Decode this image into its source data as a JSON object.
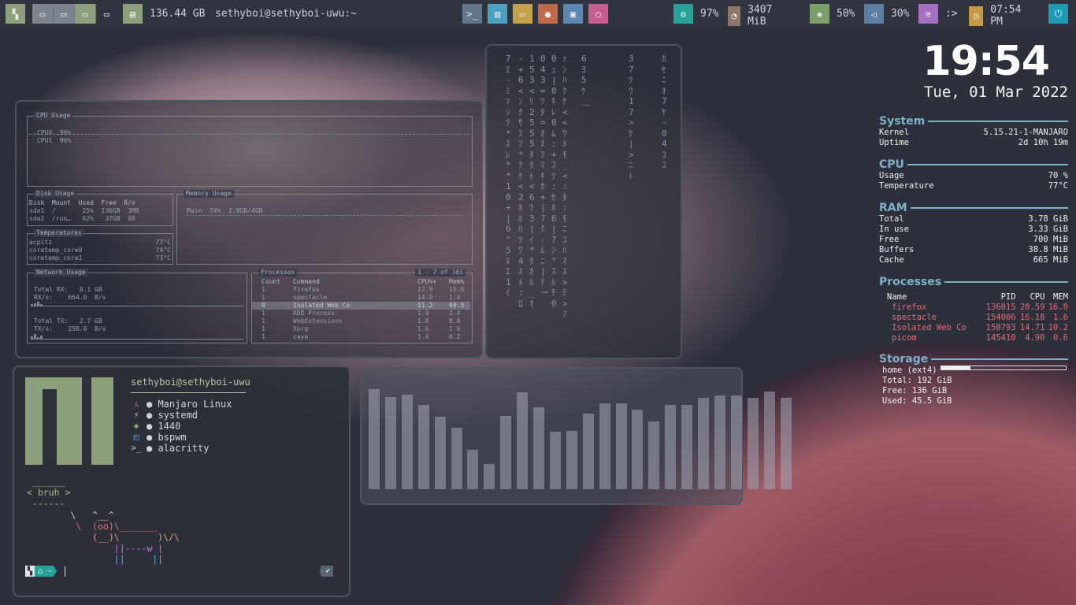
{
  "topbar": {
    "disk_value": "136.44 GB",
    "window_title": "sethyboi@sethyboi-uwu:~",
    "launchers": [
      {
        "name": "terminal-launcher",
        "icon": "terminal-icon",
        "glyph": ">_",
        "color": "#62768a"
      },
      {
        "name": "monitor-launcher",
        "icon": "bar-chart-icon",
        "glyph": "▥",
        "color": "#4ea0c2"
      },
      {
        "name": "files-launcher",
        "icon": "folder-icon",
        "glyph": "▭",
        "color": "#c5a049"
      },
      {
        "name": "firefox-launcher",
        "icon": "firefox-icon",
        "glyph": "●",
        "color": "#c16a4b"
      },
      {
        "name": "save-launcher",
        "icon": "floppy-icon",
        "glyph": "▣",
        "color": "#5d87b3"
      },
      {
        "name": "power-launcher",
        "icon": "circle-icon",
        "glyph": "○",
        "color": "#c65d8c"
      }
    ],
    "modules": [
      {
        "name": "cpu-module",
        "icon": "cpu-icon",
        "glyph": "⚙",
        "value": "97%",
        "color": "#2aa198"
      },
      {
        "name": "memory-module",
        "icon": "pie-icon",
        "glyph": "◔",
        "value": "3407 MiB",
        "color": "#8a7866"
      },
      {
        "name": "brightness-module",
        "icon": "brightness-icon",
        "glyph": "✺",
        "value": "50%",
        "color": "#7d9c69"
      },
      {
        "name": "volume-module",
        "icon": "speaker-icon",
        "glyph": "◁",
        "value": "30%",
        "color": "#5d7fa6"
      },
      {
        "name": "wifi-module",
        "icon": "wifi-icon",
        "glyph": "≋",
        "value": ":>",
        "color": "#a56fc2"
      },
      {
        "name": "clock-module",
        "icon": "clock-icon",
        "glyph": "◷",
        "value": "07:54 PM",
        "color": "#c99a45"
      },
      {
        "name": "power-module",
        "icon": "power-icon",
        "glyph": "⏻",
        "value": "",
        "color": "#1e9bb5"
      }
    ],
    "colors": {
      "bar_bg": "#2f343f",
      "workspace_inactive": "#7d838f",
      "workspace_active": "#8da07b",
      "disk": "#8da07b"
    }
  },
  "bpytop": {
    "cpu_title": "CPU Usage",
    "cpu0": "CPU0  96%",
    "cpu1": "CPU1  96%",
    "disk_title": "Disk Usage",
    "disk_header": "Disk  Mount  Used  Free  R/s",
    "disk_rows": [
      "sda1  /       25%  136GB  3MB",
      "sda2  /run…   62%   37GB  0B"
    ],
    "mem_title": "Memory Usage",
    "mem_main": "Main  74%  2.8GB/4GB",
    "temp_title": "Temperatures",
    "temps": [
      {
        "name": "acpitz",
        "value": "77°C"
      },
      {
        "name": "coretemp_core0",
        "value": "74°C"
      },
      {
        "name": "coretemp_core1",
        "value": "73°C"
      }
    ],
    "net_title": "Network Usage",
    "net_rx_total": "Total RX:   8.1 GB",
    "net_rx": "RX/s:    664.0  B/s",
    "net_tx_total": "Total TX:   2.7 GB",
    "net_tx": "TX/s:    258.0  B/s",
    "proc_title": "Processes",
    "proc_range": "1 - 7 of 161",
    "proc_headers": [
      "Count",
      "Command",
      "CPU%▾",
      "Mem%"
    ],
    "procs": [
      [
        "1",
        "firefox",
        "17.9",
        "15.6"
      ],
      [
        "1",
        "spectacle",
        "14.0",
        "1.4"
      ],
      [
        "9",
        "Isolated Web Co",
        "11.2",
        "69.5"
      ],
      [
        "1",
        "RDD Process",
        "1.9",
        "2.4"
      ],
      [
        "1",
        "WebExtensions",
        "1.8",
        "8.0"
      ],
      [
        "1",
        "Xorg",
        "1.6",
        "1.6"
      ],
      [
        "1",
        "cava",
        "1.4",
        "0.2"
      ]
    ]
  },
  "matrix": {
    "columns": [
      "7ｴ-ﾐｿｼﾂ*ｽﾚ**10+ |6\"  5ﾇｴ1ｲ",
      "-+6<ﾝｸｻｽﾌ*ｸｹ<2ﾎﾎ ﾊﾂﾜ 4ｽﾒ:ﾛ",
      "153<ﾘ2555ﾀﾀﾄ<6ﾂ3|ｲ*ﾀｶﾙ_ｵ",
      "043=ﾂﾀ=ｵﾇﾌﾏｷｶ+|7ｸ-ﾑﾆ| ﾃ ー",
      "0ｭ|0ｷﾚ0ﾑ:+ｺ ﾂ :ｾﾎ6|7ﾝ\"ｽﾙﾁ 0",
      "ｧﾝﾊｸｹ<<ﾜﾒﾓ_<:ﾀ:ﾓﾆｺﾊﾏｽ>ﾃ>ﾌ",
      "    6ﾖ5ｹ ＿",
      "37ﾂﾜ17>ｹ|>ﾆﾄ",
      "ｶｾﾆｵ7ﾔ-04ｺｺ"
    ]
  },
  "neofetch": {
    "user_host": "sethyboi@sethyboi-uwu",
    "items": [
      {
        "icon": "linux-icon",
        "glyph": "♙",
        "color": "#e06c75",
        "value": "● Manjaro Linux"
      },
      {
        "icon": "bolt-icon",
        "glyph": "⚡",
        "color": "#e5c07b",
        "value": "● systemd"
      },
      {
        "icon": "package-icon",
        "glyph": "◈",
        "color": "#98c379",
        "value": "● 1440"
      },
      {
        "icon": "windows-icon",
        "glyph": "◰",
        "color": "#61afef",
        "value": "● bspwm"
      },
      {
        "icon": "terminal-icon",
        "glyph": ">_",
        "color": "#c8ccd4",
        "value": "● alacritty"
      }
    ],
    "cow_top": " ______",
    "cow_say": "< bruh >",
    "cow_bottom": " ------",
    "cow_lines": [
      "        \\   ^__^",
      "         \\  (oo)\\_______",
      "            (__)\\       )\\/\\",
      "                ||----w |",
      "                ||     ||"
    ],
    "prompt_home": "⌂ ~",
    "prompt_ok": "✔"
  },
  "cava": {
    "levels": [
      0.94,
      0.87,
      0.89,
      0.79,
      0.68,
      0.58,
      0.37,
      0.24,
      0.69,
      0.91,
      0.77,
      0.54,
      0.55,
      0.71,
      0.81,
      0.81,
      0.75,
      0.64,
      0.79,
      0.79,
      0.86,
      0.88,
      0.88,
      0.86,
      0.92,
      0.86
    ]
  },
  "conky": {
    "clock": "19:54",
    "date": "Tue, 01 Mar 2022",
    "system_title": "System",
    "kernel_label": "Kernel",
    "kernel_value": "5.15.21-1-MANJARO",
    "uptime_label": "Uptime",
    "uptime_value": "2d 10h 19m",
    "cpu_title": "CPU",
    "usage_label": "Usage",
    "usage_value": "70 %",
    "temp_label": "Temperature",
    "temp_value": "77°C",
    "ram_title": "RAM",
    "ram": [
      {
        "label": "Total",
        "value": "3.78 GiB"
      },
      {
        "label": "In use",
        "value": "3.33 GiB"
      },
      {
        "label": "Free",
        "value": "700 MiB"
      },
      {
        "label": "Buffers",
        "value": "38.8 MiB"
      },
      {
        "label": "Cache",
        "value": "665 MiB"
      }
    ],
    "proc_title": "Processes",
    "proc_headers": [
      "Name",
      "PID",
      "CPU",
      "MEM"
    ],
    "procs": [
      [
        "firefox",
        "136015",
        "20.59",
        "16.0"
      ],
      [
        "spectacle",
        "154006",
        "16.18",
        "1.6"
      ],
      [
        "Isolated Web Co",
        "150793",
        "14.71",
        "10.2"
      ],
      [
        "picom",
        "145410",
        "4.90",
        "0.6"
      ]
    ],
    "storage_title": "Storage",
    "storage_name": "home (ext4)",
    "storage_used_fraction": 0.24,
    "storage_total": "Total: 192 GiB",
    "storage_free": "Free: 136 GiB",
    "storage_used": "Used: 45.5 GiB",
    "colors": {
      "accent": "#7fb2ca",
      "proc": "#e06c75"
    }
  }
}
